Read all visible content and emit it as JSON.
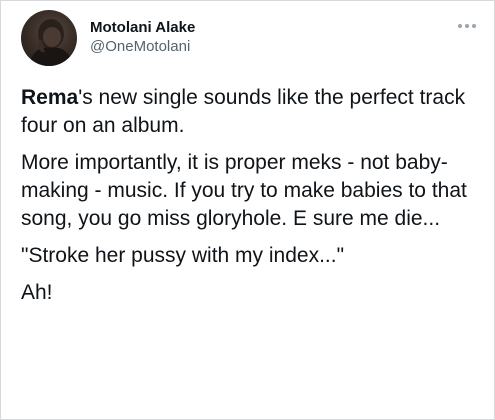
{
  "author": {
    "name": "Motolani Alake",
    "handle": "@OneMotolani",
    "avatar_icon": "profile-photo"
  },
  "menu": {
    "icon": "more-horizontal-icon"
  },
  "tweet": {
    "p1_bold": "Rema",
    "p1_rest": "'s new single sounds like the perfect track four on an album.",
    "p2": "More importantly, it is proper meks - not baby-making - music. If you try to make babies to that song, you go miss gloryhole. E sure me die...",
    "p3": "\"Stroke her pussy with my index...\"",
    "p4": "Ah!"
  },
  "colors": {
    "text": "#0f1419",
    "secondary": "#536471",
    "border": "#d6d9db",
    "background": "#ffffff"
  }
}
